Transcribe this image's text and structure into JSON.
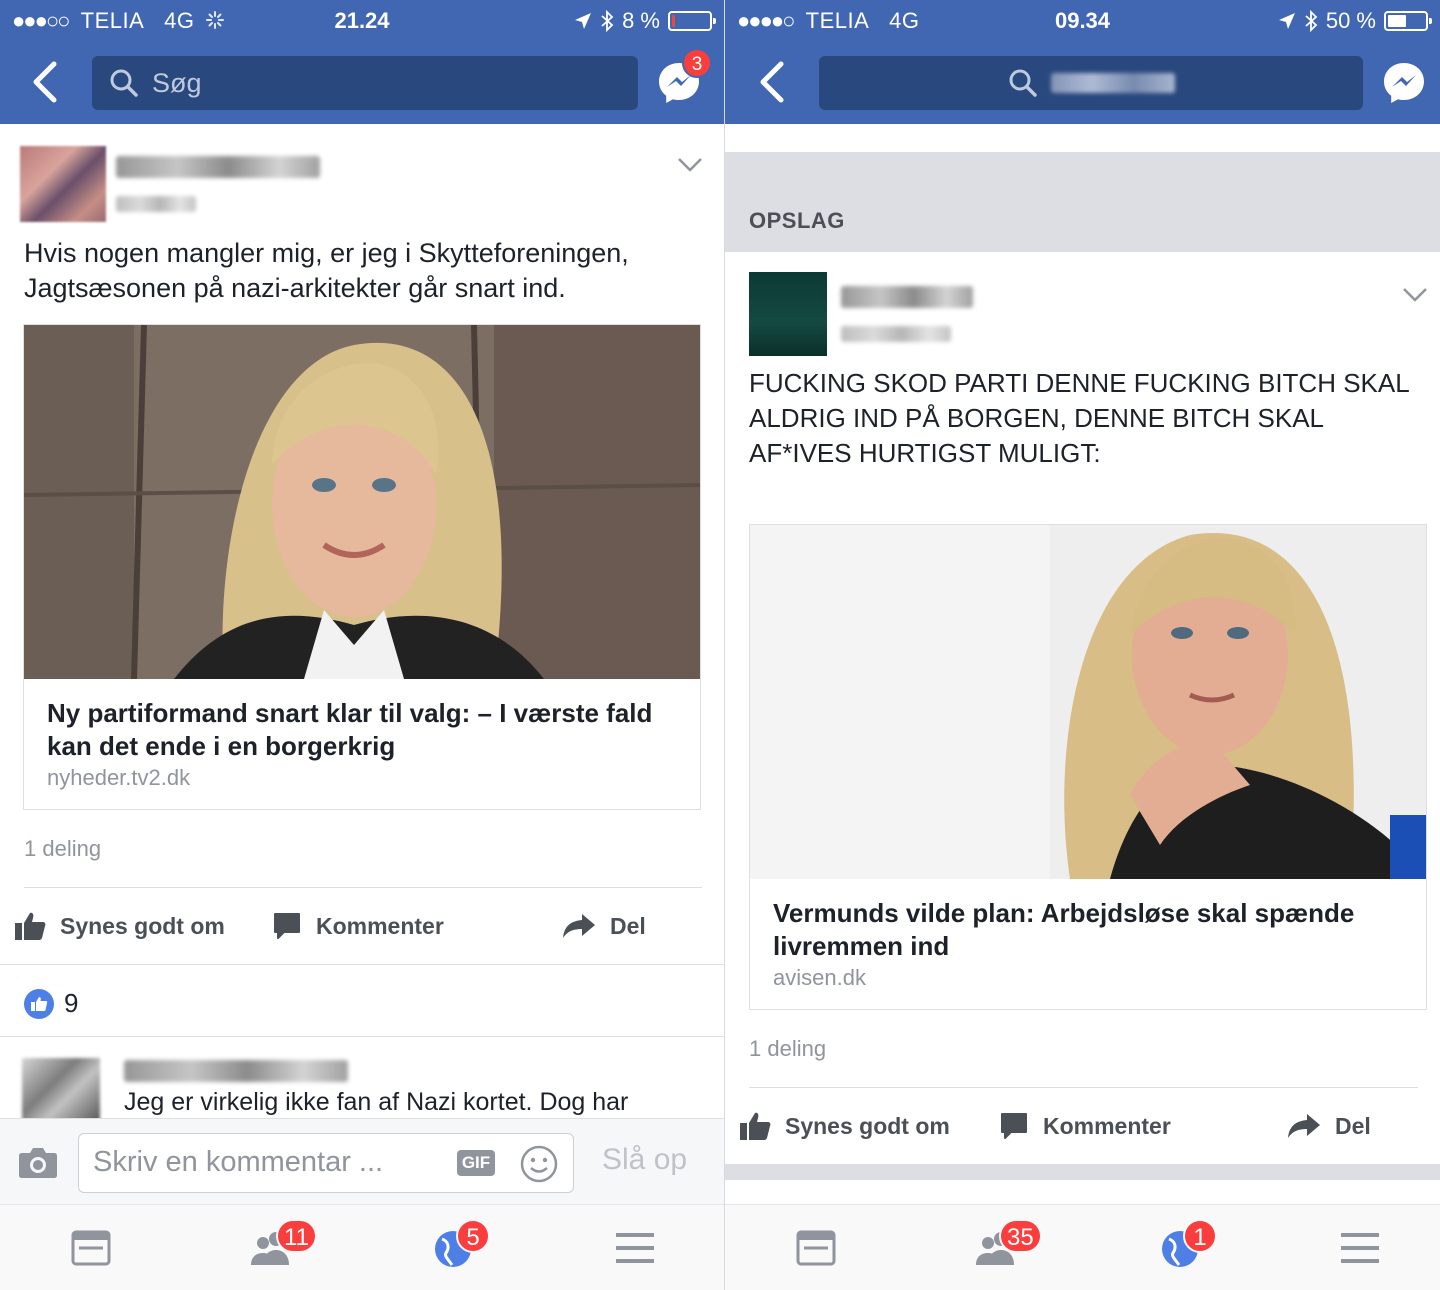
{
  "colors": {
    "brand": "#4267b2",
    "badge": "#fa3e3e",
    "battery_low": "#e84b3c",
    "battery_ok": "#ffffff"
  },
  "left": {
    "status": {
      "signal": "●●●○○",
      "carrier": "TELIA",
      "network": "4G",
      "time": "21.24",
      "battery_percent": "8 %",
      "battery_level": 0.08
    },
    "search": {
      "placeholder": "Søg"
    },
    "messenger_badge": "3",
    "post": {
      "text": "Hvis nogen mangler mig, er jeg i Skytteforeningen, Jagtsæsonen på nazi-arkitekter går snart ind.",
      "link": {
        "title": "Ny partiformand snart klar til valg: – I værste fald kan det ende i en borgerkrig",
        "domain": "nyheder.tv2.dk"
      },
      "shares": "1 deling",
      "actions": {
        "like": "Synes godt om",
        "comment": "Kommenter",
        "share": "Del"
      },
      "like_count": "9",
      "comment_preview": "Jeg er virkelig ikke fan af Nazi kortet. Dog har"
    },
    "composer": {
      "placeholder": "Skriv en kommentar ...",
      "gif": "GIF",
      "post_button": "Slå op"
    },
    "tabbar": {
      "friends_badge": "11",
      "notifications_badge": "5"
    }
  },
  "right": {
    "status": {
      "signal": "●●●●○",
      "carrier": "TELIA",
      "network": "4G",
      "time": "09.34",
      "battery_percent": "50 %",
      "battery_level": 0.5
    },
    "section_label": "OPSLAG",
    "post": {
      "text": "FUCKING SKOD PARTI DENNE FUCKING BITCH SKAL ALDRIG IND PÅ BORGEN, DENNE BITCH SKAL AF*IVES HURTIGST MULIGT:",
      "link": {
        "title": "Vermunds vilde plan: Arbejdsløse skal spænde livremmen ind",
        "domain": "avisen.dk"
      },
      "shares": "1 deling",
      "actions": {
        "like": "Synes godt om",
        "comment": "Kommenter",
        "share": "Del"
      }
    },
    "tabbar": {
      "friends_badge": "35",
      "notifications_badge": "1"
    }
  }
}
